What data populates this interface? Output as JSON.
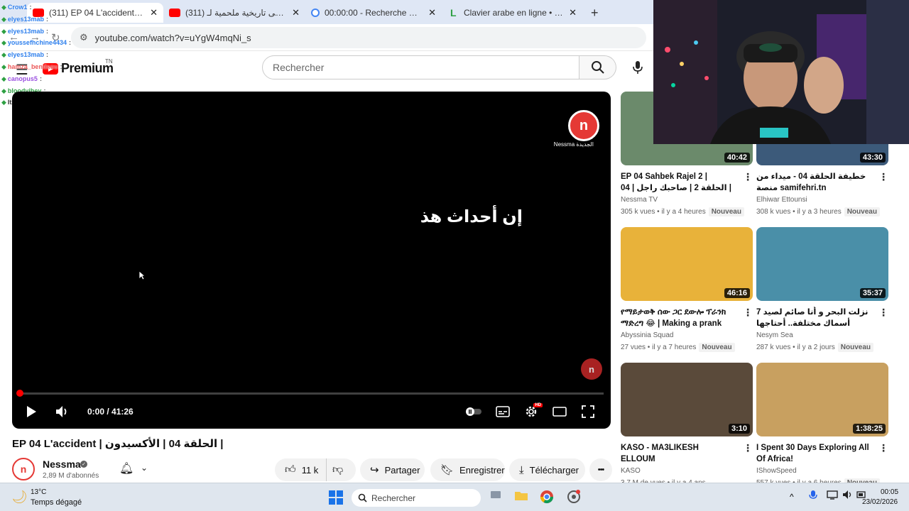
{
  "tabs": [
    {
      "title": "(311) EP 04 L'accident | الأكسيدون",
      "close": "✕",
      "color": "#ff0000",
      "active": true
    },
    {
      "title": "(311) موسيقى تاريخية ملحمية لـ",
      "close": "✕",
      "color": "#ff0000",
      "active": false
    },
    {
      "title": "00:00:00 - Recherche Google",
      "close": "✕",
      "color": "#4285f4",
      "active": false
    },
    {
      "title": "Clavier arabe en ligne • Lexilogos",
      "close": "✕",
      "color": "#2ea043",
      "active": false
    }
  ],
  "new_tab": "+",
  "address": {
    "url": "youtube.com/watch?v=uYgW4mqNi_s",
    "site_info_icon": "site-info-icon"
  },
  "chat": [
    {
      "user": "Crow1",
      "msg": "",
      "color": "#2f80ed"
    },
    {
      "user": "elyes13mab",
      "msg": "",
      "color": "#2f80ed"
    },
    {
      "user": "elyes13mab",
      "msg": "",
      "color": "#2f80ed"
    },
    {
      "user": "youssefhchine4434",
      "msg": "",
      "color": "#2f80ed"
    },
    {
      "user": "elyes13mab",
      "msg": "",
      "color": "#2f80ed"
    },
    {
      "user": "hamza_bendaou",
      "msg": "",
      "color": "#eb5757"
    },
    {
      "user": "canopus5",
      "msg": "",
      "color": "#9b51e0"
    },
    {
      "user": "bloodyjhey",
      "msg": "",
      "color": "#2ea043"
    },
    {
      "user": "Itz_RevoXx",
      "msg": "",
      "color": "#333333"
    }
  ],
  "youtube": {
    "logo_text": "Premium",
    "region": "TN",
    "search_placeholder": "Rechercher",
    "icons": {
      "hamburger": "menu-icon",
      "search": "search-icon",
      "mic": "mic-icon"
    }
  },
  "player": {
    "subtitle": "إن أحداث هذ",
    "logo_letter": "n",
    "logo_sub": "Nessma الجديدة",
    "time": "0:00 / 41:26",
    "progress": 0.003,
    "icons": [
      "play-icon",
      "volume-icon",
      "autoplay-toggle-icon",
      "subtitles-icon",
      "settings-icon",
      "theater-icon",
      "fullscreen-icon"
    ],
    "settings_badge": "HD"
  },
  "video": {
    "title": "EP 04 L'accident | الحلقة 04 | الأكسيدون |",
    "channel": "Nessma",
    "subscribers": "2,89 M d'abonnés",
    "likes": "11 k",
    "share": "Partager",
    "save": "Enregistrer",
    "download": "Télécharger",
    "more": "•••"
  },
  "recommendations": [
    {
      "title": "EP 04 Sahbek Rajel 2 | الحلقة 2 | صاحبك راجل | 04 |",
      "channel": "Nessma TV",
      "views": "305 k vues",
      "age": "il y a 4 heures",
      "badge": "Nouveau",
      "duration": "40:42",
      "bg": "#6b8a6b"
    },
    {
      "title": "خطيفة الحلقة 04 - ميداء من منصة samifehri.tn",
      "channel": "Elhiwar Ettounsi",
      "views": "308 k vues",
      "age": "il y a 3 heures",
      "badge": "Nouveau",
      "duration": "43:30",
      "bg": "#3c5a7a"
    },
    {
      "title": "የማይታወቅ ሰው ጋር ደውሎ ፕራንክ ማድረግ 😂 | Making a prank c...",
      "channel": "Abyssinia Squad",
      "views": "27 vues",
      "age": "il y a 7 heures",
      "badge": "Nouveau",
      "duration": "46:16",
      "bg": "#e8b23a"
    },
    {
      "title": "نزلت البحر و أنا صائم لصيد 7 أسماك مختلفة.. أحتاجها لطهي فطور رمضان!",
      "channel": "Nesym Sea",
      "views": "287 k vues",
      "age": "il y a 2 jours",
      "badge": "Nouveau",
      "duration": "35:37",
      "bg": "#4a8fa8"
    },
    {
      "title": "KASO - MA3LIKESH ELLOUM",
      "channel": "KASO",
      "views": "3,7 M de vues",
      "age": "il y a 4 ans",
      "badge": "",
      "duration": "3:10",
      "bg": "#5a4a3a"
    },
    {
      "title": "I Spent 30 Days Exploring All Of Africa!",
      "channel": "IShowSpeed",
      "views": "557 k vues",
      "age": "il y a 6 heures",
      "badge": "Nouveau",
      "duration": "1:38:25",
      "bg": "#c8a060"
    }
  ],
  "kebab": "⋮",
  "taskbar": {
    "temperature": "13°C",
    "weather": "Temps dégagé",
    "search": "Rechercher",
    "time": "00:05",
    "date": "23/02/2026",
    "icons": [
      "weather-moon-icon",
      "windows-start-icon",
      "search-icon",
      "task-view-icon",
      "file-explorer-icon",
      "chrome-icon",
      "chrome-alt-icon",
      "chevron-up-icon",
      "mic-icon",
      "wifi-icon",
      "speaker-icon",
      "battery-icon"
    ]
  },
  "colors": {
    "yt_red": "#ff0000",
    "nessma_red": "#e53935"
  }
}
